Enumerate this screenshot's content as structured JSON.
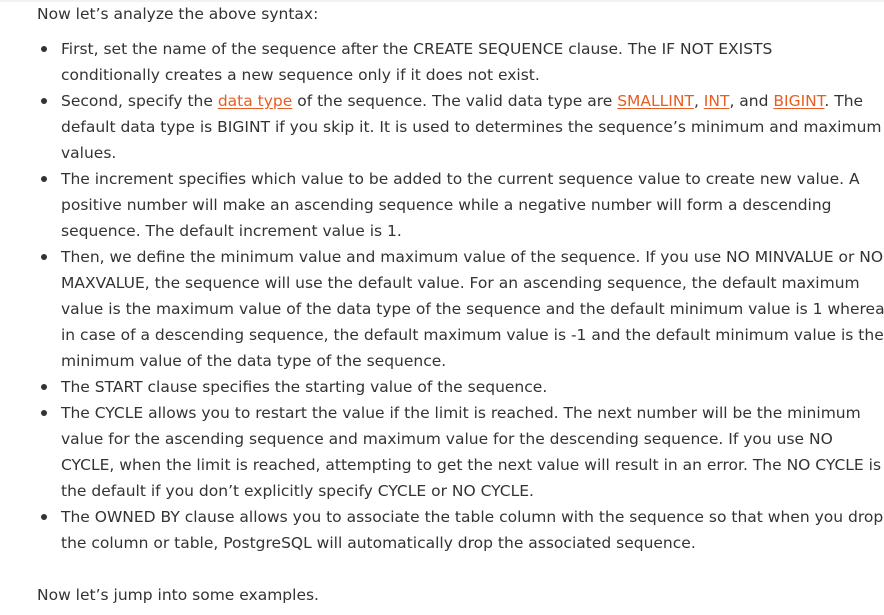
{
  "intro": "Now let’s analyze the above syntax:",
  "bullets": [
    {
      "lines": [
        "First, set the name of the sequence after the CREATE SEQUENCE clause. The IF NOT EXISTS",
        "conditionally creates a new sequence only if it does not exist."
      ]
    },
    {
      "l1_a": "Second, specify the ",
      "link_data_type": "data type",
      "l1_b": " of the sequence. The valid data type are ",
      "link_smallint": "SMALLINT",
      "sep1": ", ",
      "link_int": "INT",
      "sep2": ", and ",
      "link_bigint": "BIGINT",
      "l1_c": ". The",
      "lines": [
        "default data type is BIGINT if you skip it. It is used to determines the sequence’s minimum and maximum",
        "values."
      ]
    },
    {
      "lines": [
        "The increment specifies which value to be added to the current sequence value to create new value. A",
        "positive number will make an ascending sequence while a negative number will form a descending",
        "sequence. The default increment value is 1."
      ]
    },
    {
      "lines": [
        "Then, we define the minimum value and maximum value of the sequence. If you use NO MINVALUE or NO",
        "MAXVALUE, the sequence will use the default value. For an ascending sequence, the default maximum",
        "value is the maximum value of the data type of the sequence and the default minimum value is 1 whereas",
        "in case of a descending sequence, the default maximum value is -1 and the default minimum value is the",
        "minimum value of the data type of the sequence."
      ]
    },
    {
      "lines": [
        "The START clause specifies the starting value of the sequence."
      ]
    },
    {
      "lines": [
        "The CYCLE allows you to restart the value if the limit is reached. The next number will be the minimum",
        "value for the ascending sequence and maximum value for the descending sequence. If you use NO",
        "CYCLE, when the limit is reached, attempting to get the next value will result in an error. The NO CYCLE is",
        "the default if you don’t explicitly specify CYCLE or NO CYCLE."
      ]
    },
    {
      "lines": [
        "The OWNED BY clause allows you to associate the table column with the sequence so that when you drop",
        "the column or table, PostgreSQL will automatically drop the associated sequence."
      ]
    }
  ],
  "outro": "Now let’s jump into some examples.",
  "colors": {
    "text": "#333333",
    "link": "#e85d22"
  }
}
